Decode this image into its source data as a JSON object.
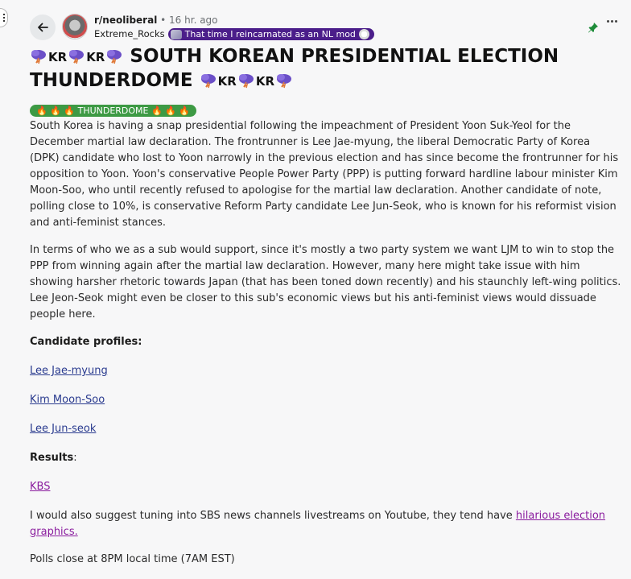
{
  "header": {
    "subreddit": "r/neoliberal",
    "separator": "•",
    "time_ago": "16 hr. ago",
    "username": "Extreme_Rocks",
    "user_flair": "That time I reincarnated as an NL mod"
  },
  "post": {
    "title_text": "SOUTH KOREAN PRESIDENTIAL ELECTION THUNDERDOME",
    "kr_label": "KR",
    "flair": {
      "fire": "🔥 🔥 🔥",
      "label": "THUNDERDOME",
      "fire_end": "🔥 🔥 🔥"
    },
    "para1": "South Korea is having a snap presidential following the impeachment of President Yoon Suk-Yeol for the December martial law declaration. The frontrunner is Lee Jae-myung, the liberal Democratic Party of Korea (DPK) candidate who lost to Yoon narrowly in the previous election and has since become the frontrunner for his opposition to Yoon. Yoon's conservative People Power Party (PPP) is putting forward hardline labour minister Kim Moon-Soo, who until recently refused to apologise for the martial law declaration. Another candidate of note, polling close to 10%, is conservative Reform Party candidate Lee Jun-Seok, who is known for his reformist vision and anti-feminist stances.",
    "para2": "In terms of who we as a sub would support, since it's mostly a two party system we want LJM to win to stop the PPP from winning again after the martial law declaration. However, many here might take issue with him showing harsher rhetoric towards Japan (that has been toned down recently) and his staunchly left-wing politics. Lee Jeon-Seok might even be closer to this sub's economic views but his anti-feminist views would dissuade people here.",
    "candidate_heading": "Candidate profiles:",
    "candidates": [
      "Lee Jae-myung",
      "Kim Moon-Soo",
      "Lee Jun-seok"
    ],
    "results_heading": "Results",
    "results_colon": ":",
    "results_link": "KBS",
    "suggest_text": "I would also suggest tuning into SBS news channels livestreams on Youtube, they tend have ",
    "suggest_link": "hilarious election graphics.",
    "polls_text": "Polls close at 8PM local time (7AM EST)"
  },
  "colors": {
    "flair_green": "#3d9a44",
    "user_flair_purple": "#4b1e8a",
    "link_blue": "#2a3b8f",
    "link_visited": "#8a1c9e",
    "pin_green": "#1e8c3a"
  },
  "icons": [
    "back-arrow-icon",
    "pin-icon",
    "more-icon",
    "storm-cloud-icon"
  ]
}
